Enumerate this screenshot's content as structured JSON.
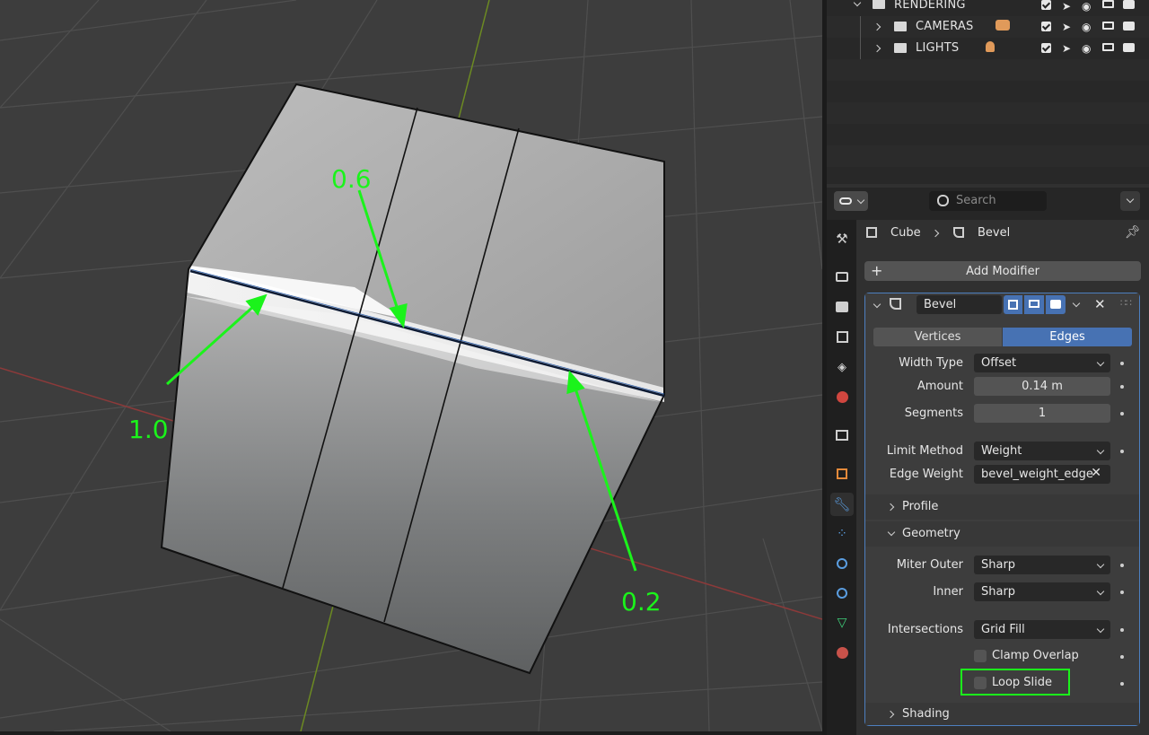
{
  "viewport": {
    "annotations": [
      "0.6",
      "1.0",
      "0.2"
    ]
  },
  "outliner": {
    "rows": [
      {
        "label": "RENDERING",
        "expanded": true
      },
      {
        "label": "CAMERAS",
        "expanded": false
      },
      {
        "label": "LIGHTS",
        "expanded": false
      }
    ]
  },
  "properties": {
    "search_placeholder": "Search",
    "breadcrumb": {
      "object": "Cube",
      "modifier": "Bevel"
    },
    "add_modifier_label": "Add Modifier",
    "modifier": {
      "name": "Bevel",
      "affect_tabs": [
        "Vertices",
        "Edges"
      ],
      "active_affect": "Edges",
      "width_type": {
        "label": "Width Type",
        "value": "Offset"
      },
      "amount": {
        "label": "Amount",
        "value": "0.14 m"
      },
      "segments": {
        "label": "Segments",
        "value": "1"
      },
      "limit_method": {
        "label": "Limit Method",
        "value": "Weight"
      },
      "edge_weight": {
        "label": "Edge Weight",
        "value": "bevel_weight_edge"
      },
      "profile_label": "Profile",
      "geometry_label": "Geometry",
      "miter_outer": {
        "label": "Miter Outer",
        "value": "Sharp"
      },
      "inner": {
        "label": "Inner",
        "value": "Sharp"
      },
      "intersections": {
        "label": "Intersections",
        "value": "Grid Fill"
      },
      "clamp_overlap": {
        "label": "Clamp Overlap",
        "checked": false
      },
      "loop_slide": {
        "label": "Loop Slide",
        "checked": false
      },
      "shading_label": "Shading"
    }
  },
  "colors": {
    "annotation_green": "#1bf31b",
    "active_blue": "#4772b3",
    "panel_border": "#4d7fbf"
  }
}
